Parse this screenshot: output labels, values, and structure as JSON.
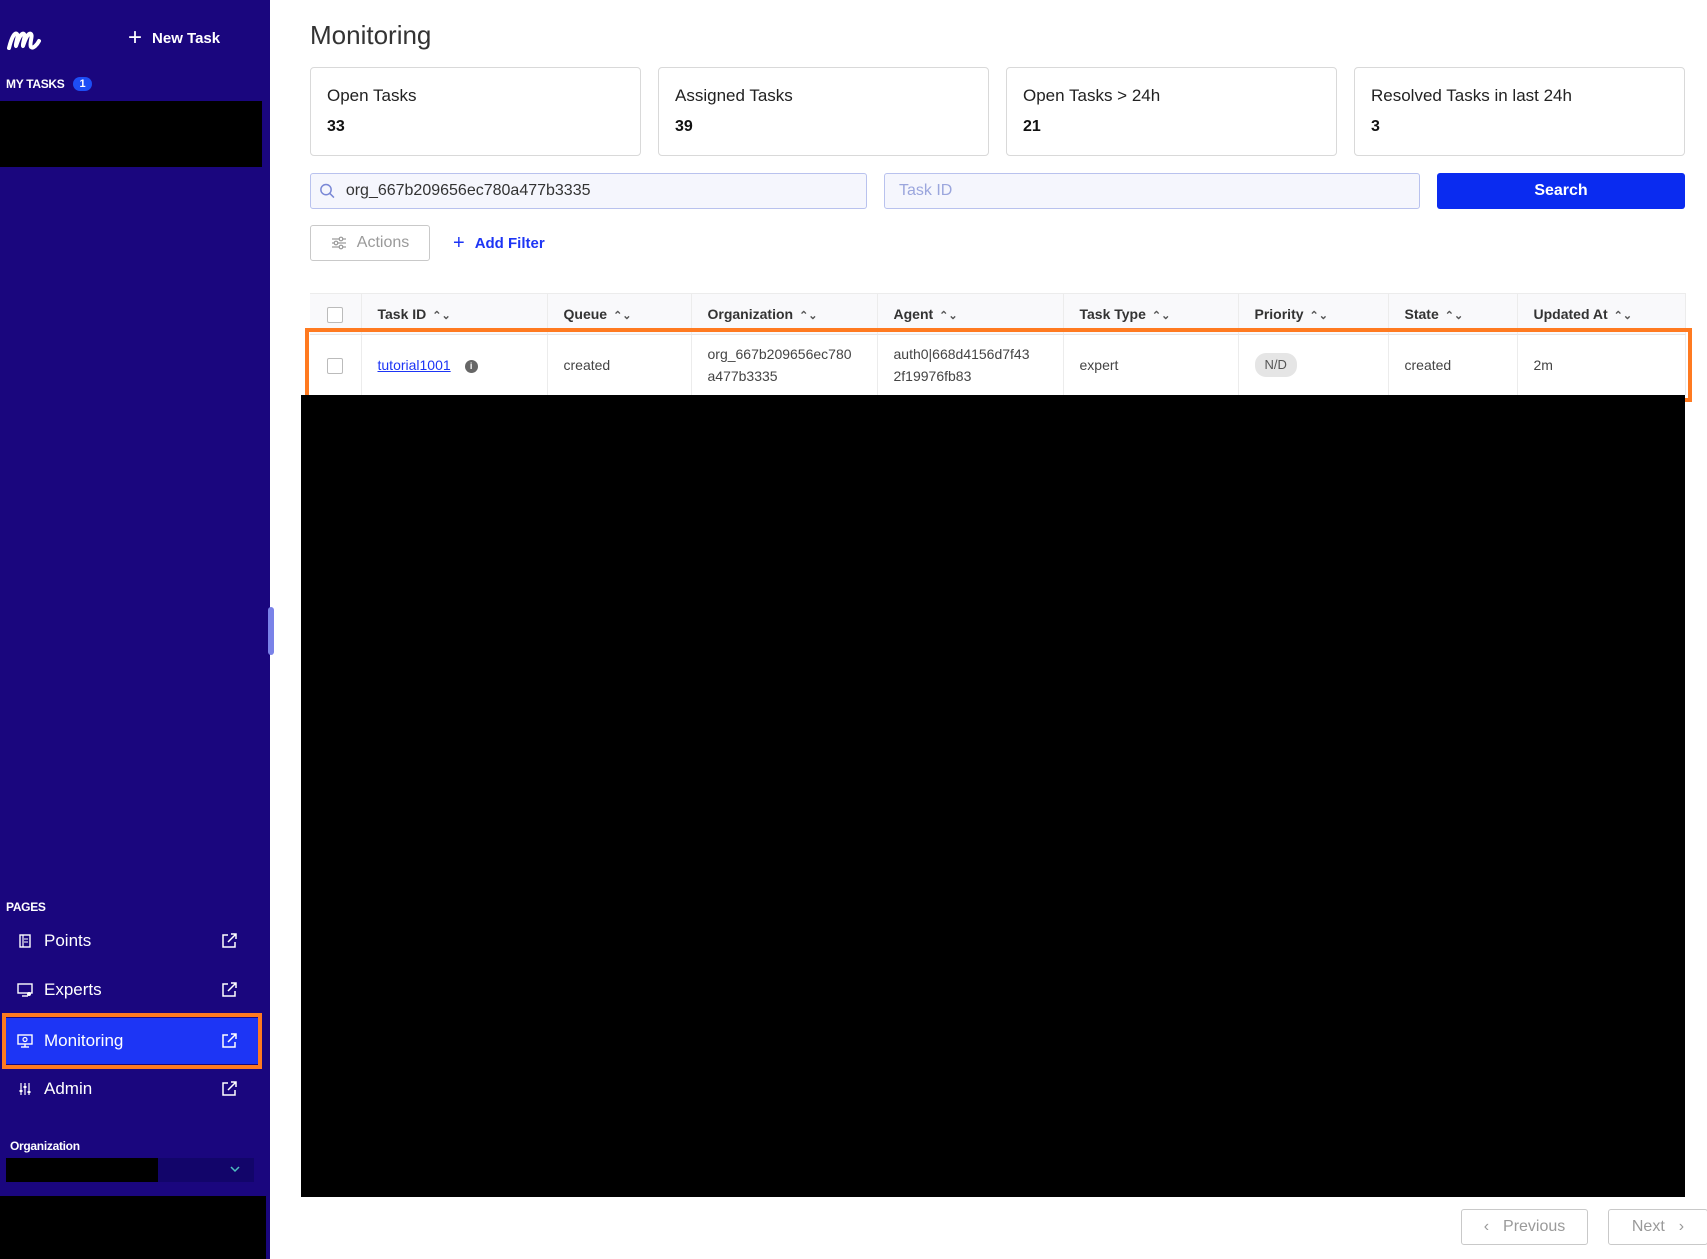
{
  "sidebar": {
    "new_task_label": "New Task",
    "my_tasks_label": "MY TASKS",
    "my_tasks_count": "1",
    "pages_label": "PAGES",
    "items": [
      {
        "label": "Points",
        "icon": "points-icon"
      },
      {
        "label": "Experts",
        "icon": "experts-icon"
      },
      {
        "label": "Monitoring",
        "icon": "monitoring-icon",
        "active": true
      },
      {
        "label": "Admin",
        "icon": "admin-icon"
      }
    ],
    "organization_label": "Organization"
  },
  "main": {
    "title": "Monitoring",
    "stats": [
      {
        "label": "Open Tasks",
        "value": "33"
      },
      {
        "label": "Assigned Tasks",
        "value": "39"
      },
      {
        "label": "Open Tasks > 24h",
        "value": "21"
      },
      {
        "label": "Resolved Tasks in last 24h",
        "value": "3"
      }
    ],
    "search": {
      "value": "org_667b209656ec780a477b3335",
      "task_id_placeholder": "Task ID",
      "button_label": "Search"
    },
    "actions_label": "Actions",
    "add_filter_label": "Add Filter",
    "table": {
      "columns": [
        "Task ID",
        "Queue",
        "Organization",
        "Agent",
        "Task Type",
        "Priority",
        "State",
        "Updated At"
      ],
      "rows": [
        {
          "task_id": "tutorial1001",
          "queue": "created",
          "organization_line1": "org_667b209656ec780",
          "organization_line2": "a477b3335",
          "agent_line1": "auth0|668d4156d7f43",
          "agent_line2": "2f19976fb83",
          "task_type": "expert",
          "priority": "N/D",
          "state": "created",
          "updated_at": "2m"
        }
      ]
    },
    "pagination": {
      "previous_label": "Previous",
      "next_label": "Next"
    }
  },
  "colors": {
    "sidebar_bg": "#1a067e",
    "accent": "#1d35f5",
    "highlight": "#ff7a20"
  }
}
